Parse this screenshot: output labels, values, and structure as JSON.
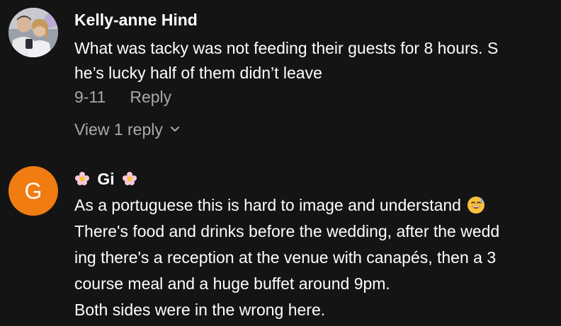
{
  "comments": [
    {
      "author": "Kelly-anne Hind",
      "avatar_icon": "profile-photo",
      "text_lines": [
        "What was tacky was not feeding their guests for 8 hours. S",
        "he’s lucky half of them didn’t leave"
      ],
      "date": "9-11",
      "reply_label": "Reply",
      "view_replies_label": "View 1 reply"
    },
    {
      "author": "Gi",
      "author_decoration_icon": "flower-emoji",
      "avatar_letter": "G",
      "avatar_color": "#f07c12",
      "text_lines": [
        "As a portuguese this is hard to image and understand",
        "There's food and drinks before the wedding, after the wedd",
        "ing there's a reception at the venue with canapés, then a 3",
        "course meal and a huge buffet around 9pm.",
        "Both sides were in the wrong here."
      ],
      "inline_emoji": "sweat-smile-emoji"
    }
  ],
  "colors": {
    "background": "#141414",
    "text": "#ffffff",
    "secondary_text": "#a9a9a9"
  }
}
